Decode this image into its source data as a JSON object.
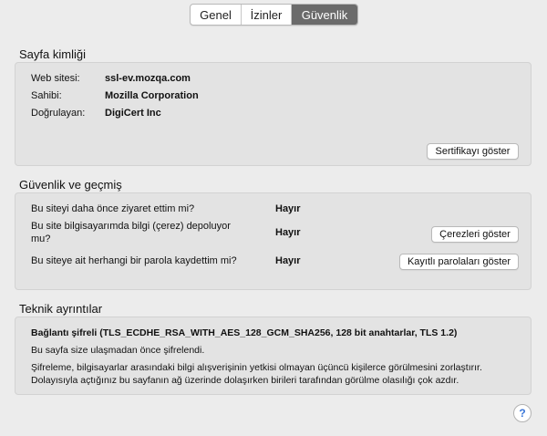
{
  "tabs": [
    {
      "label": "Genel"
    },
    {
      "label": "İzinler"
    },
    {
      "label": "Güvenlik",
      "selected": true
    }
  ],
  "identity": {
    "title": "Sayfa kimliği",
    "website_label": "Web sitesi:",
    "website_value": "ssl-ev.mozqa.com",
    "owner_label": "Sahibi:",
    "owner_value": "Mozilla Corporation",
    "verifier_label": "Doğrulayan:",
    "verifier_value": "DigiCert Inc",
    "show_cert_button": "Sertifikayı göster"
  },
  "privacy": {
    "title": "Güvenlik ve geçmiş",
    "q1": "Bu siteyi daha önce ziyaret ettim mi?",
    "a1": "Hayır",
    "q2_line1": "Bu site bilgisayarımda bilgi (çerez) depoluyor",
    "q2_line2": "mu?",
    "a2": "Hayır",
    "q3": "Bu siteye ait herhangi bir parola kaydettim mi?",
    "a3": "Hayır",
    "cookies_button": "Çerezleri göster",
    "passwords_button": "Kayıtlı parolaları göster"
  },
  "technical": {
    "title": "Teknik ayrıntılar",
    "connection": "Bağlantı şifreli (TLS_ECDHE_RSA_WITH_AES_128_GCM_SHA256, 128 bit anahtarlar, TLS 1.2)",
    "line1": "Bu sayfa size ulaşmadan önce şifrelendi.",
    "line2": "Şifreleme, bilgisayarlar arasındaki bilgi alışverişinin yetkisi olmayan üçüncü kişilerce görülmesini zorlaştırır.",
    "line3": "Dolayısıyla açtığınız bu sayfanın ağ üzerinde dolaşırken birileri tarafından görülme olasılığı çok azdır."
  },
  "help": {
    "glyph": "?"
  }
}
